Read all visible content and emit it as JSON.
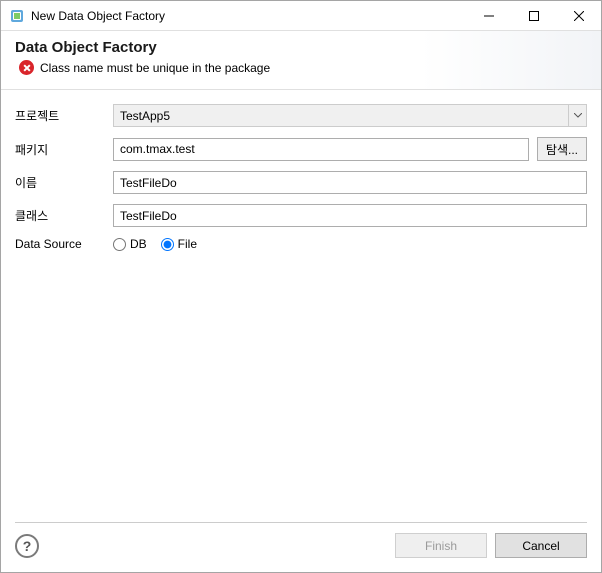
{
  "window": {
    "title": "New Data Object Factory"
  },
  "header": {
    "title": "Data Object Factory",
    "error_message": "Class name must be unique in the package"
  },
  "form": {
    "project_label": "프로젝트",
    "project_value": "TestApp5",
    "package_label": "패키지",
    "package_value": "com.tmax.test",
    "browse_label": "탐색...",
    "name_label": "이름",
    "name_value": "TestFileDo",
    "class_label": "클래스",
    "class_value": "TestFileDo",
    "datasource_label": "Data Source",
    "radio_db": "DB",
    "radio_file": "File",
    "datasource_selected": "File"
  },
  "footer": {
    "help": "?",
    "finish": "Finish",
    "cancel": "Cancel"
  }
}
